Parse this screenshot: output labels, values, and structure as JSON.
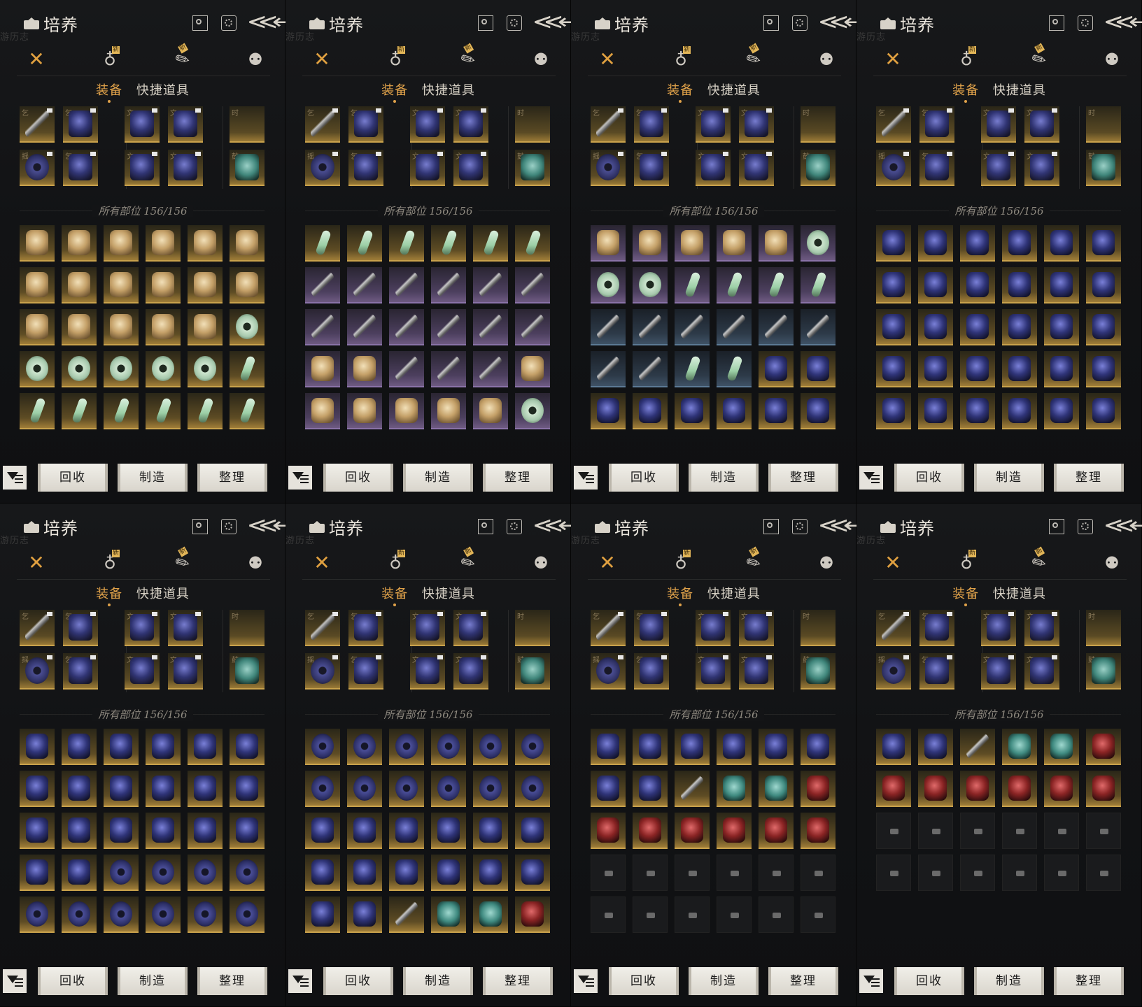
{
  "panels_count": 8,
  "header": {
    "title": "培养",
    "watermark": "游历志",
    "back_glyph": "≪←",
    "icons": [
      "bag-icon",
      "search-icon",
      "gear-icon",
      "back-arrow-icon"
    ]
  },
  "category_tabs": [
    {
      "icon": "crossed-swords-icon",
      "glyph": "✕",
      "active": true,
      "new_badge": ""
    },
    {
      "icon": "pouch-icon",
      "glyph": "♁",
      "active": false,
      "new_badge": "新"
    },
    {
      "icon": "scroll-icon",
      "glyph": "✎",
      "active": false,
      "new_badge": "新"
    },
    {
      "icon": "token-icon",
      "glyph": "⚉",
      "active": false,
      "new_badge": ""
    }
  ],
  "sub_tabs": {
    "equipment": "装备",
    "quick_items": "快捷道具"
  },
  "parts_label": "所有部位 156/156",
  "actions": {
    "recycle": "回收",
    "craft": "制造",
    "sort": "整理"
  },
  "colors": {
    "accent": "#e0a24a",
    "gold_slot": "#c9a24c",
    "purple_slot": "#8a73a8",
    "blue_slot": "#5c7a95",
    "button_bg": "#e6e3dc",
    "panel_bg": "#121315"
  },
  "equipped_glyphs": [
    "乞",
    "乞",
    "文",
    "文",
    "时",
    "摇",
    "乞",
    "文",
    "文",
    "鼓"
  ],
  "inventory_pages": [
    {
      "rows": [
        [
          "gold:bronze",
          "gold:bronze",
          "gold:bronze",
          "gold:bronze",
          "gold:bronze",
          "gold:bronze"
        ],
        [
          "gold:bronze",
          "gold:bronze",
          "gold:bronze",
          "gold:bronze",
          "gold:bronze",
          "gold:bronze"
        ],
        [
          "gold:bronze",
          "gold:bronze",
          "gold:bronze",
          "gold:bronze",
          "gold:bronze",
          "gold:jade"
        ],
        [
          "gold:jade",
          "gold:jade",
          "gold:jade",
          "gold:jade",
          "gold:jade",
          "gold:jadeshard"
        ],
        [
          "gold:jadeshard",
          "gold:jadeshard",
          "gold:jadeshard",
          "gold:jadeshard",
          "gold:jadeshard",
          "gold:jadeshard"
        ]
      ]
    },
    {
      "rows": [
        [
          "gold:jadeshard",
          "gold:jadeshard",
          "gold:jadeshard",
          "gold:jadeshard",
          "gold:jadeshard",
          "gold:jadeshard"
        ],
        [
          "purple:blade",
          "purple:blade",
          "purple:blade",
          "purple:blade",
          "purple:blade",
          "purple:blade"
        ],
        [
          "purple:blade",
          "purple:blade",
          "purple:blade",
          "purple:blade",
          "purple:blade",
          "purple:blade"
        ],
        [
          "purple:bronze",
          "purple:bronze",
          "purple:blade",
          "purple:blade",
          "purple:blade",
          "purple:bronze"
        ],
        [
          "purple:bronze",
          "purple:bronze",
          "purple:bronze",
          "purple:bronze",
          "purple:bronze",
          "purple:jade"
        ]
      ]
    },
    {
      "rows": [
        [
          "purple:bronze",
          "purple:bronze",
          "purple:bronze",
          "purple:bronze",
          "purple:bronze",
          "purple:jade"
        ],
        [
          "purple:jade",
          "purple:jade",
          "purple:jadeshard",
          "purple:jadeshard",
          "purple:jadeshard",
          "purple:jadeshard"
        ],
        [
          "blue:blade",
          "blue:blade",
          "blue:blade",
          "blue:blade",
          "blue:blade",
          "blue:blade"
        ],
        [
          "blue:blade",
          "blue:blade",
          "blue:jadeshard",
          "blue:jadeshard",
          "gold:navy",
          "gold:navy"
        ],
        [
          "gold:navy",
          "gold:navy",
          "gold:navy",
          "gold:navy",
          "gold:navy",
          "gold:navy"
        ]
      ]
    },
    {
      "rows": [
        [
          "gold:navy",
          "gold:navy",
          "gold:navy",
          "gold:navy",
          "gold:navy",
          "gold:navy"
        ],
        [
          "gold:navy",
          "gold:navy",
          "gold:navy",
          "gold:navy",
          "gold:navy",
          "gold:navy"
        ],
        [
          "gold:navy",
          "gold:navy",
          "gold:navy",
          "gold:navy",
          "gold:navy",
          "gold:navy"
        ],
        [
          "gold:navy",
          "gold:navy",
          "gold:navy",
          "gold:navy",
          "gold:navy",
          "gold:navy"
        ],
        [
          "gold:navy",
          "gold:navy",
          "gold:navy",
          "gold:navy",
          "gold:navy",
          "gold:navy"
        ]
      ]
    },
    {
      "rows": [
        [
          "gold:navy",
          "gold:navy",
          "gold:navy",
          "gold:navy",
          "gold:navy",
          "gold:navy"
        ],
        [
          "gold:navy",
          "gold:navy",
          "gold:navy",
          "gold:navy",
          "gold:navy",
          "gold:navy"
        ],
        [
          "gold:navy",
          "gold:navy",
          "gold:navy",
          "gold:navy",
          "gold:navy",
          "gold:navy"
        ],
        [
          "gold:navy",
          "gold:navy",
          "gold:navyring",
          "gold:navyring",
          "gold:navyring",
          "gold:navyring"
        ],
        [
          "gold:navyring",
          "gold:navyring",
          "gold:navyring",
          "gold:navyring",
          "gold:navyring",
          "gold:navyring"
        ]
      ]
    },
    {
      "rows": [
        [
          "gold:navyring",
          "gold:navyring",
          "gold:navyring",
          "gold:navyring",
          "gold:navyring",
          "gold:navyring"
        ],
        [
          "gold:navyring",
          "gold:navyring",
          "gold:navyring",
          "gold:navyring",
          "gold:navyring",
          "gold:navyring"
        ],
        [
          "gold:navy",
          "gold:navy",
          "gold:navy",
          "gold:navy",
          "gold:navy",
          "gold:navy"
        ],
        [
          "gold:navy",
          "gold:navy",
          "gold:navy",
          "gold:navy",
          "gold:navy",
          "gold:navy"
        ],
        [
          "gold:navy",
          "gold:navy",
          "gold:blade",
          "gold:teal",
          "gold:teal",
          "gold:crimson"
        ]
      ]
    },
    {
      "rows": [
        [
          "gold:navy",
          "gold:navy",
          "gold:navy",
          "gold:navy",
          "gold:navy",
          "gold:navy"
        ],
        [
          "gold:navy",
          "gold:navy",
          "gold:blade",
          "gold:teal",
          "gold:teal",
          "gold:crimson"
        ],
        [
          "gold:crimson",
          "gold:crimson",
          "gold:crimson",
          "gold:crimson",
          "gold:crimson",
          "gold:crimson"
        ],
        [
          "empty",
          "empty",
          "empty",
          "empty",
          "empty",
          "empty"
        ],
        [
          "empty",
          "empty",
          "empty",
          "empty",
          "empty",
          "empty"
        ]
      ]
    },
    {
      "rows": [
        [
          "gold:navy",
          "gold:navy",
          "gold:blade",
          "gold:teal",
          "gold:teal",
          "gold:crimson"
        ],
        [
          "gold:crimson",
          "gold:crimson",
          "gold:crimson",
          "gold:crimson",
          "gold:crimson",
          "gold:crimson"
        ],
        [
          "empty",
          "empty",
          "empty",
          "empty",
          "empty",
          "empty"
        ],
        [
          "empty",
          "empty",
          "empty",
          "empty",
          "empty",
          "empty"
        ]
      ]
    }
  ]
}
